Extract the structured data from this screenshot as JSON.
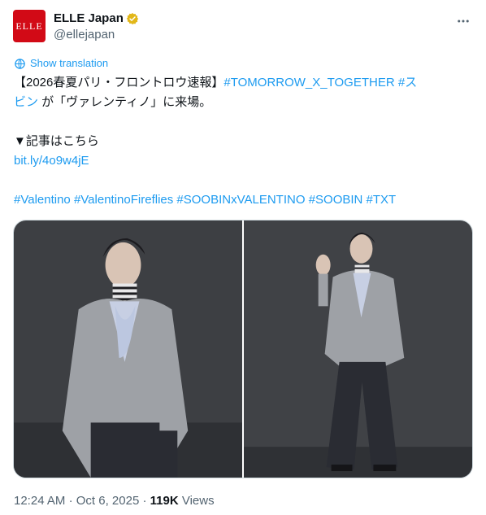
{
  "author": {
    "display_name": "ELLE Japan",
    "handle": "@ellejapan",
    "avatar_text": "ELLE",
    "verified_icon": "gold-verified-badge-icon",
    "more_icon": "more-horizontal-icon"
  },
  "translate": {
    "label": "Show translation",
    "icon": "translate-icon"
  },
  "tweet": {
    "line1_prefix": "【2026春夏パリ・フロントロウ速報】",
    "hashtag_txt_group": "#TOMORROW_X_TOGETHER",
    "hashtag_supin_part1": "#ス",
    "hashtag_supin_part2": "ビン",
    "line2_suffix": " が「ヴァレンティノ」に来場。",
    "article_label": "▼記事はこちら",
    "link": "bit.ly/4o9w4jE",
    "hashtags": [
      "#Valentino",
      "#ValentinoFireflies",
      "#SOOBINxVALENTINO",
      "#SOOBIN",
      "#TXT"
    ]
  },
  "media": {
    "photos": [
      "photo-1",
      "photo-2"
    ]
  },
  "meta": {
    "time": "12:24 AM",
    "separator": "·",
    "date": "Oct 6, 2025",
    "views_count": "119K",
    "views_label": "Views"
  },
  "colors": {
    "link": "#1d9bf0",
    "text": "#0f1419",
    "secondary": "#536471",
    "avatar_bg": "#d20a16",
    "badge": "#e2b719"
  }
}
